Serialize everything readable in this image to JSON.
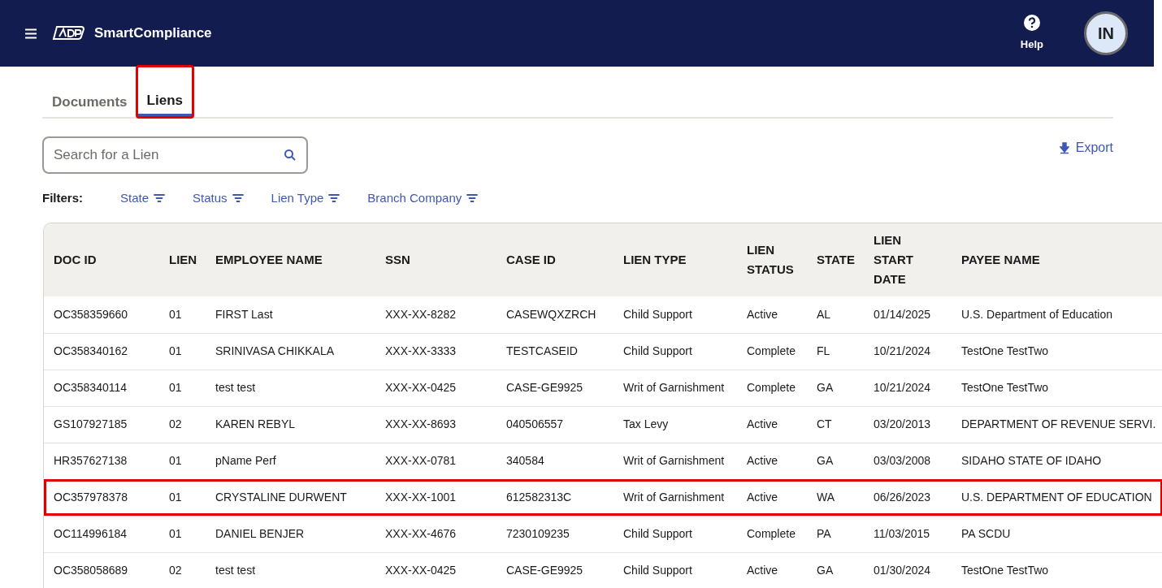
{
  "header": {
    "app_name": "SmartCompliance",
    "help_label": "Help",
    "avatar_initials": "IN"
  },
  "tabs": [
    {
      "label": "Documents",
      "selected": false,
      "annotated": false
    },
    {
      "label": "Liens",
      "selected": true,
      "annotated": true
    }
  ],
  "search": {
    "placeholder": "Search for a Lien"
  },
  "export_label": "Export",
  "filters": {
    "label": "Filters:",
    "items": [
      "State",
      "Status",
      "Lien Type",
      "Branch Company"
    ]
  },
  "table": {
    "columns": [
      "DOC ID",
      "LIEN",
      "EMPLOYEE NAME",
      "SSN",
      "CASE ID",
      "LIEN TYPE",
      "LIEN STATUS",
      "STATE",
      "LIEN START DATE",
      "PAYEE NAME"
    ],
    "rows": [
      {
        "annotated": false,
        "cells": [
          "OC358359660",
          "01",
          "FIRST Last",
          "XXX-XX-8282",
          "CASEWQXZRCH",
          "Child Support",
          "Active",
          "AL",
          "01/14/2025",
          "U.S. Department of Education"
        ]
      },
      {
        "annotated": false,
        "cells": [
          "OC358340162",
          "01",
          "SRINIVASA CHIKKALA",
          "XXX-XX-3333",
          "TESTCASEID",
          "Child Support",
          "Complete",
          "FL",
          "10/21/2024",
          "TestOne TestTwo"
        ]
      },
      {
        "annotated": false,
        "cells": [
          "OC358340114",
          "01",
          "test test",
          "XXX-XX-0425",
          "CASE-GE9925",
          "Writ of Garnishment",
          "Complete",
          "GA",
          "10/21/2024",
          "TestOne TestTwo"
        ]
      },
      {
        "annotated": false,
        "cells": [
          "GS107927185",
          "02",
          "KAREN REBYL",
          "XXX-XX-8693",
          "040506557",
          "Tax Levy",
          "Active",
          "CT",
          "03/20/2013",
          "DEPARTMENT OF REVENUE SERVI."
        ]
      },
      {
        "annotated": false,
        "cells": [
          "HR357627138",
          "01",
          "pName Perf",
          "XXX-XX-0781",
          "340584",
          "Writ of Garnishment",
          "Active",
          "GA",
          "03/03/2008",
          "SIDAHO STATE OF IDAHO"
        ]
      },
      {
        "annotated": true,
        "cells": [
          "OC357978378",
          "01",
          "CRYSTALINE DURWENT",
          "XXX-XX-1001",
          "612582313C",
          "Writ of Garnishment",
          "Active",
          "WA",
          "06/26/2023",
          "U.S. DEPARTMENT OF EDUCATION"
        ]
      },
      {
        "annotated": false,
        "cells": [
          "OC114996184",
          "01",
          "DANIEL BENJER",
          "XXX-XX-4676",
          "7230109235",
          "Child Support",
          "Complete",
          "PA",
          "11/03/2015",
          "PA SCDU"
        ]
      },
      {
        "annotated": false,
        "cells": [
          "OC358058689",
          "02",
          "test test",
          "XXX-XX-0425",
          "CASE-GE9925",
          "Child Support",
          "Active",
          "GA",
          "01/30/2024",
          "TestOne TestTwo"
        ]
      }
    ]
  }
}
